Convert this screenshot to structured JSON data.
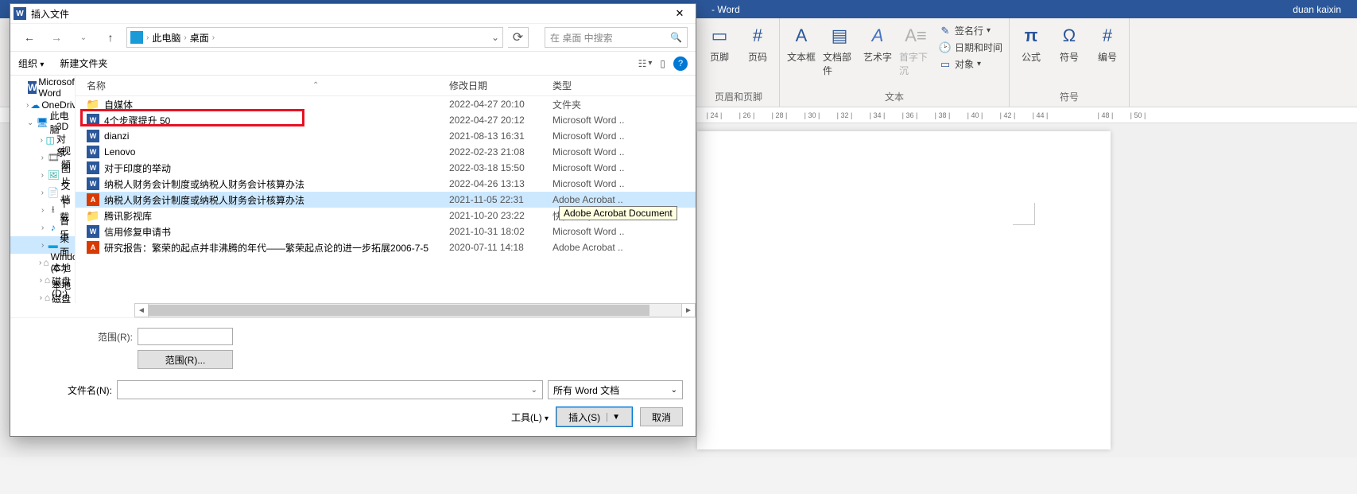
{
  "word_window": {
    "app_title": "- Word",
    "user_name": "duan kaixin"
  },
  "ribbon": {
    "groups": {
      "header_footer": {
        "footer_label": "页脚",
        "pagenum_label": "页码",
        "group_label": "页眉和页脚"
      },
      "text": {
        "textbox_label": "文本框",
        "docpart_label": "文档部件",
        "wordart_label": "艺术字",
        "dropcap_label": "首字下沉",
        "sigline_label": "签名行",
        "datetime_label": "日期和时间",
        "object_label": "对象",
        "group_label": "文本"
      },
      "symbols": {
        "equation_label": "公式",
        "symbol_label": "符号",
        "number_label": "编号",
        "group_label": "符号"
      }
    }
  },
  "ruler_ticks": [
    "| 24 |",
    "| 26 |",
    "| 28 |",
    "| 30 |",
    "| 32 |",
    "| 34 |",
    "| 36 |",
    "| 38 |",
    "| 40 |",
    "| 42 |",
    "| 44 |",
    "",
    "| 48 |",
    "| 50 |"
  ],
  "dialog": {
    "title": "插入文件",
    "breadcrumb": {
      "root": "此电脑",
      "leaf": "桌面"
    },
    "search_placeholder": "在 桌面 中搜索",
    "toolbar": {
      "organize": "组织",
      "newfolder": "新建文件夹"
    },
    "columns": {
      "name": "名称",
      "date": "修改日期",
      "type": "类型"
    },
    "tree": [
      {
        "kind": "word",
        "label": "Microsoft Word",
        "indent": 1,
        "chev": ""
      },
      {
        "kind": "onedrive",
        "label": "OneDrive",
        "indent": 1,
        "chev": "›"
      },
      {
        "kind": "monitor",
        "label": "此电脑",
        "indent": 1,
        "chev": "⌄"
      },
      {
        "kind": "3d",
        "label": "3D 对象",
        "indent": 2,
        "chev": "›"
      },
      {
        "kind": "video",
        "label": "视频",
        "indent": 2,
        "chev": "›"
      },
      {
        "kind": "pic",
        "label": "图片",
        "indent": 2,
        "chev": "›"
      },
      {
        "kind": "doc",
        "label": "文档",
        "indent": 2,
        "chev": "›"
      },
      {
        "kind": "dl",
        "label": "下载",
        "indent": 2,
        "chev": "›"
      },
      {
        "kind": "music",
        "label": "音乐",
        "indent": 2,
        "chev": "›"
      },
      {
        "kind": "desktop",
        "label": "桌面",
        "indent": 2,
        "chev": "›",
        "selected": true
      },
      {
        "kind": "disk",
        "label": "Windows (C:)",
        "indent": 2,
        "chev": "›"
      },
      {
        "kind": "disk",
        "label": "本地磁盘 (D:)",
        "indent": 2,
        "chev": "›"
      },
      {
        "kind": "disk",
        "label": "本地磁盘 (E:)",
        "indent": 2,
        "chev": "›"
      }
    ],
    "files": [
      {
        "icon": "folder",
        "name": "自媒体",
        "date": "2022-04-27 20:10",
        "type": "文件夹"
      },
      {
        "icon": "word",
        "name": "4个步骤提升 50",
        "date": "2022-04-27 20:12",
        "type": "Microsoft Word ..",
        "highlighted": true
      },
      {
        "icon": "word",
        "name": "dianzi",
        "date": "2021-08-13 16:31",
        "type": "Microsoft Word .."
      },
      {
        "icon": "word",
        "name": "Lenovo",
        "date": "2022-02-23 21:08",
        "type": "Microsoft Word .."
      },
      {
        "icon": "word",
        "name": "对于印度的举动",
        "date": "2022-03-18 15:50",
        "type": "Microsoft Word .."
      },
      {
        "icon": "word",
        "name": "纳税人财务会计制度或纳税人财务会计核算办法",
        "date": "2022-04-26 13:13",
        "type": "Microsoft Word .."
      },
      {
        "icon": "pdf",
        "name": "纳税人财务会计制度或纳税人财务会计核算办法",
        "date": "2021-11-05 22:31",
        "type": "Adobe Acrobat ..",
        "selected": true,
        "tooltip": "Adobe Acrobat Document"
      },
      {
        "icon": "shortcut",
        "name": "腾讯影视库",
        "date": "2021-10-20 23:22",
        "type": "快捷方式"
      },
      {
        "icon": "word",
        "name": "信用修复申请书",
        "date": "2021-10-31 18:02",
        "type": "Microsoft Word .."
      },
      {
        "icon": "pdf",
        "name": "研究报告：繁荣的起点并非沸腾的年代——繁荣起点论的进一步拓展2006-7-5",
        "date": "2020-07-11 14:18",
        "type": "Adobe Acrobat .."
      }
    ],
    "footer": {
      "range_label": "范围(R):",
      "range_btn": "范围(R)...",
      "filename_label": "文件名(N):",
      "filter_label": "所有 Word 文档",
      "tools_label": "工具(L)",
      "insert_label": "插入(S)",
      "cancel_label": "取消"
    }
  }
}
